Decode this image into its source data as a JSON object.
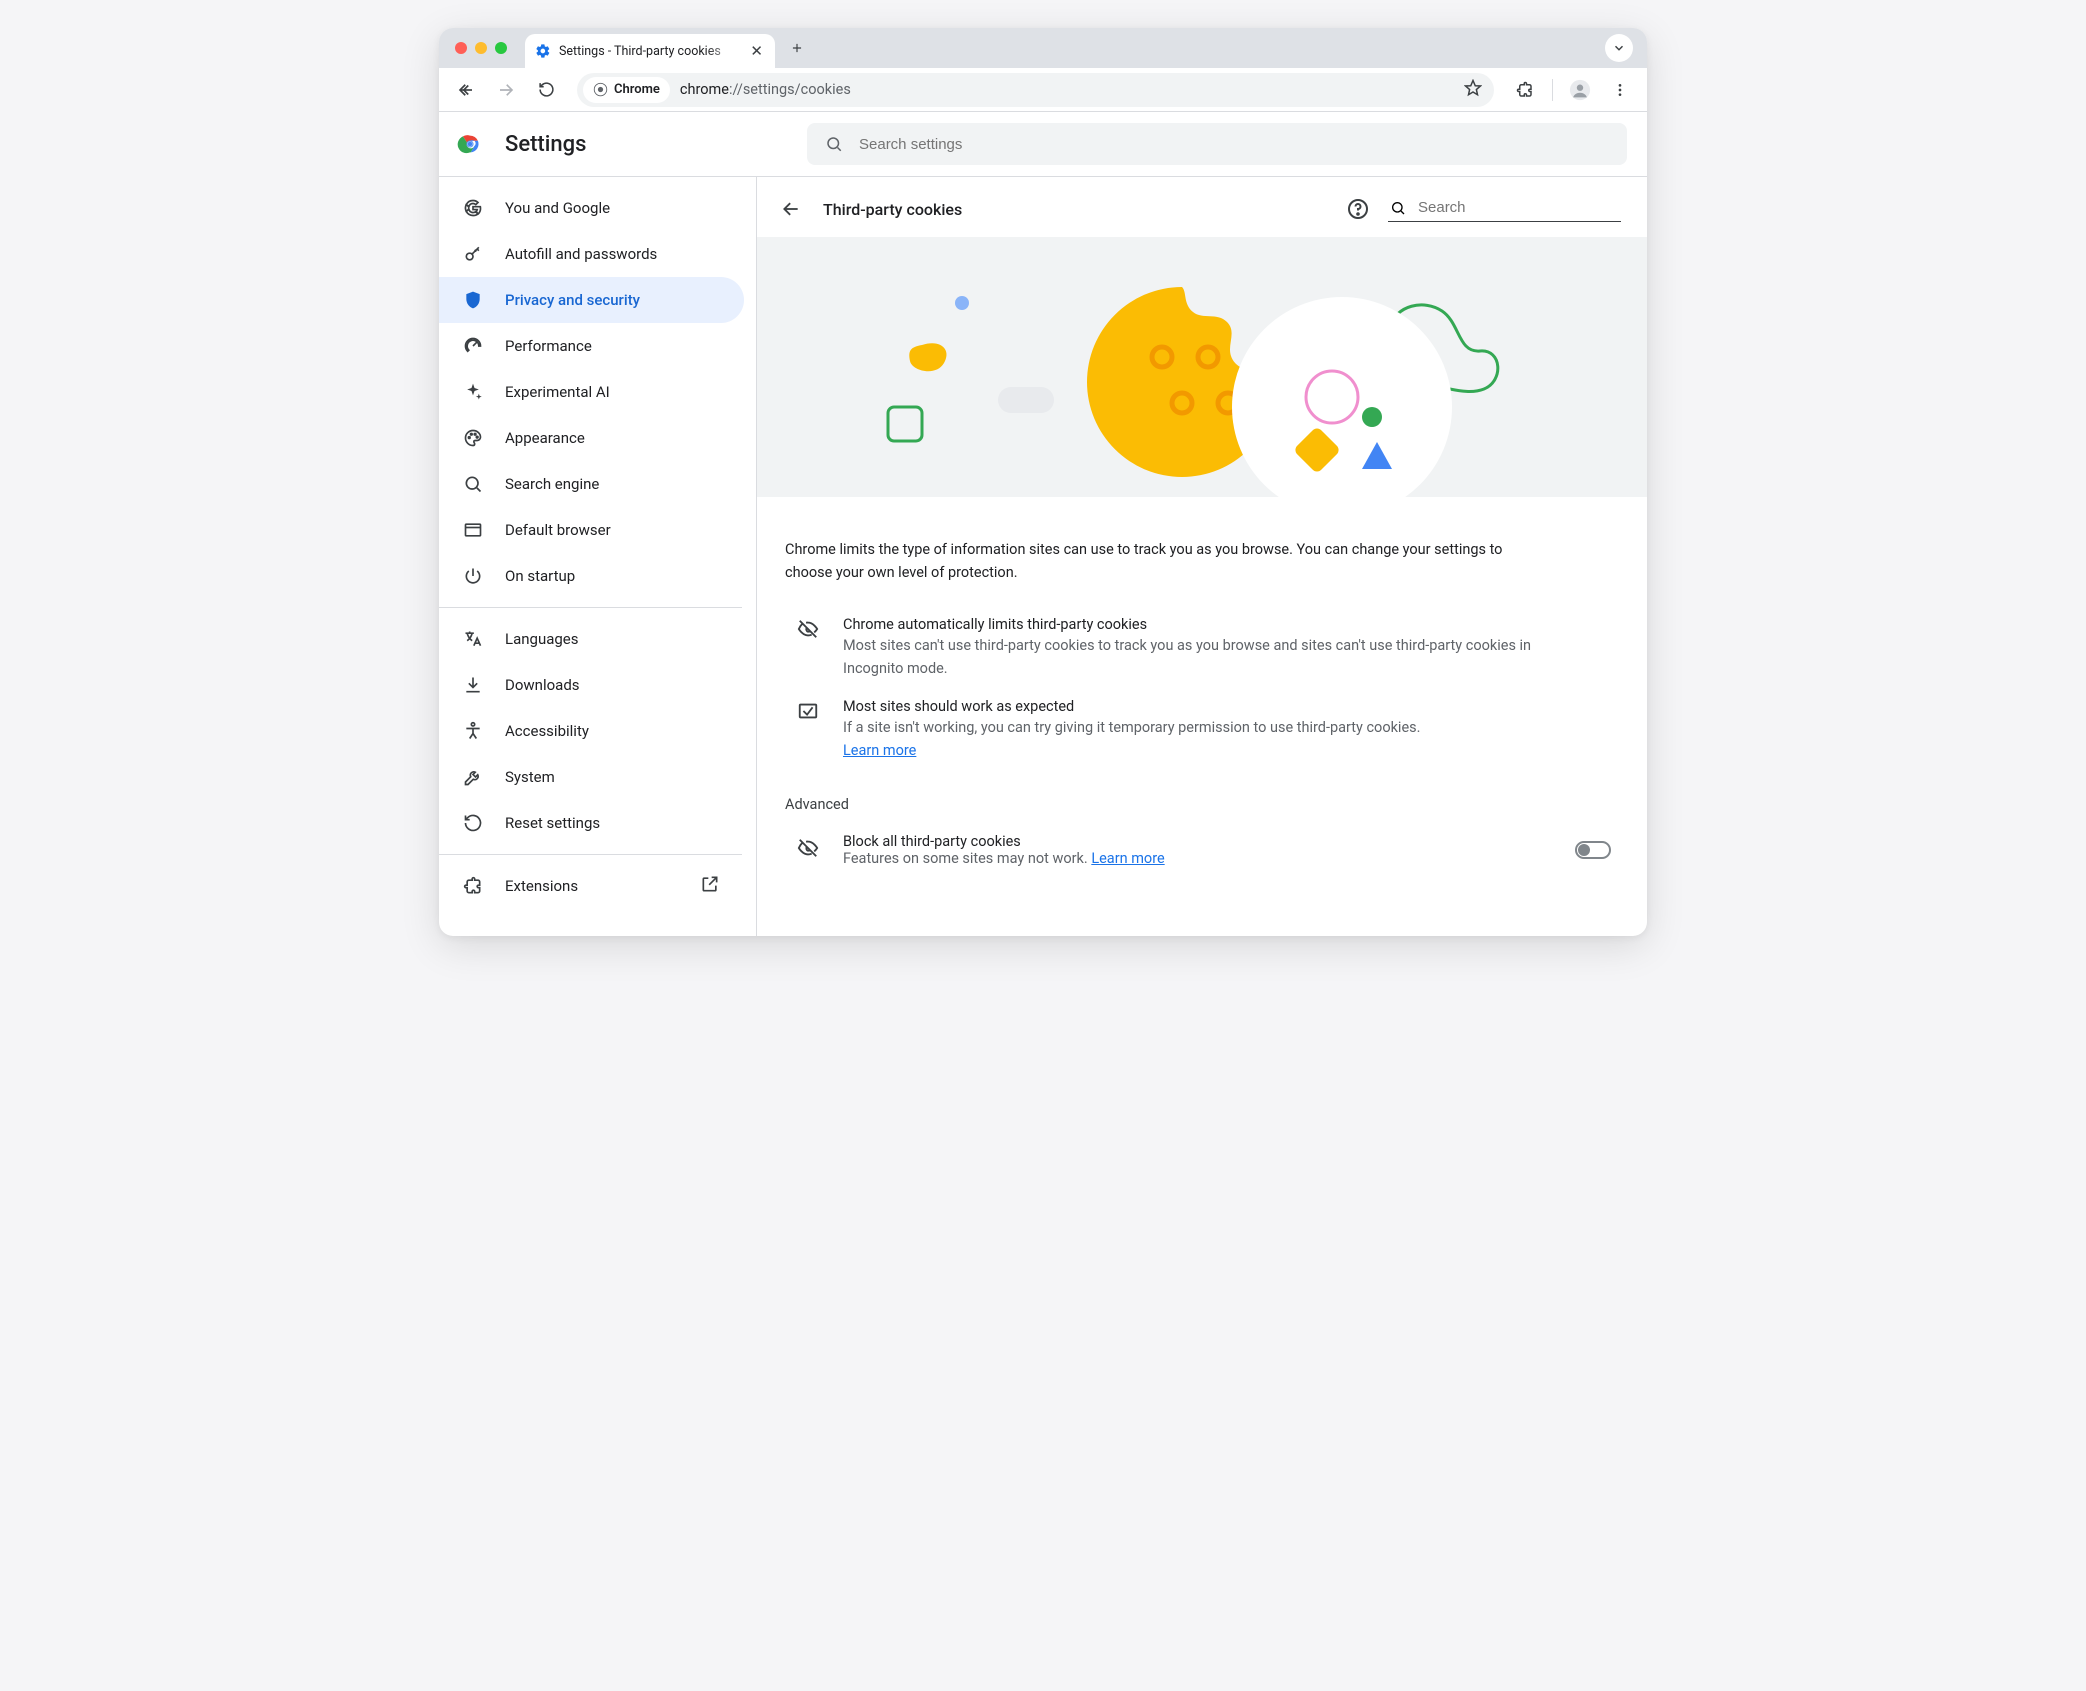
{
  "browser": {
    "tab_title": "Settings - Third-party cookies",
    "omnibox_chip": "Chrome",
    "omnibox_url_scheme": "chrome",
    "omnibox_url_rest": "://settings/cookies"
  },
  "header": {
    "app_title": "Settings",
    "search_placeholder": "Search settings"
  },
  "sidebar": {
    "items": [
      {
        "label": "You and Google"
      },
      {
        "label": "Autofill and passwords"
      },
      {
        "label": "Privacy and security"
      },
      {
        "label": "Performance"
      },
      {
        "label": "Experimental AI"
      },
      {
        "label": "Appearance"
      },
      {
        "label": "Search engine"
      },
      {
        "label": "Default browser"
      },
      {
        "label": "On startup"
      }
    ],
    "items2": [
      {
        "label": "Languages"
      },
      {
        "label": "Downloads"
      },
      {
        "label": "Accessibility"
      },
      {
        "label": "System"
      },
      {
        "label": "Reset settings"
      }
    ],
    "items3": [
      {
        "label": "Extensions"
      }
    ]
  },
  "page": {
    "title": "Third-party cookies",
    "search_placeholder": "Search",
    "lead": "Chrome limits the type of information sites can use to track you as you browse. You can change your settings to choose your own level of protection.",
    "info1_title": "Chrome automatically limits third-party cookies",
    "info1_body": "Most sites can't use third-party cookies to track you as you browse and sites can't use third-party cookies in Incognito mode.",
    "info2_title": "Most sites should work as expected",
    "info2_body": "If a site isn't working, you can try giving it temporary permission to use third-party cookies. ",
    "info2_link": "Learn more",
    "advanced_label": "Advanced",
    "block_title": "Block all third-party cookies",
    "block_body": "Features on some sites may not work. ",
    "block_link": "Learn more"
  }
}
